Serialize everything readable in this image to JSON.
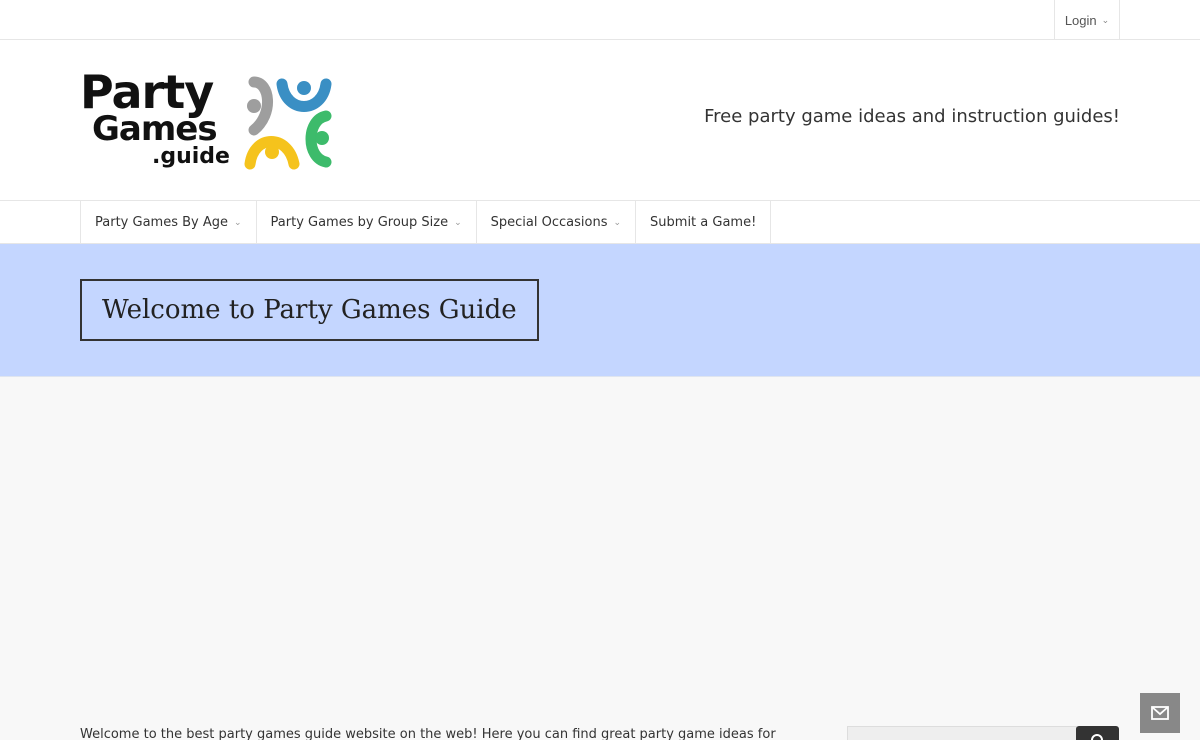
{
  "topbar": {
    "login_label": "Login"
  },
  "header": {
    "logo_line1": "Party",
    "logo_line2": "Games",
    "logo_line3": ".guide",
    "tagline": "Free party game ideas and instruction guides!"
  },
  "nav": {
    "items": [
      {
        "label": "Party Games By Age"
      },
      {
        "label": "Party Games by Group Size"
      },
      {
        "label": "Special Occasions"
      },
      {
        "label": "Submit a Game!"
      }
    ]
  },
  "hero": {
    "title": "Welcome to Party Games Guide"
  },
  "content": {
    "intro_text": "Welcome to the best party games guide website on the web!  Here you can find great party game ideas for all ages and"
  },
  "colors": {
    "hero_bg": "#c4d6ff",
    "logo_gray": "#9e9e9e",
    "logo_blue": "#3a8fc4",
    "logo_green": "#3dbb6b",
    "logo_yellow": "#f5c31c"
  },
  "icons": [
    "chevron-down-icon",
    "logo-people-icon",
    "search-icon",
    "mail-icon"
  ]
}
